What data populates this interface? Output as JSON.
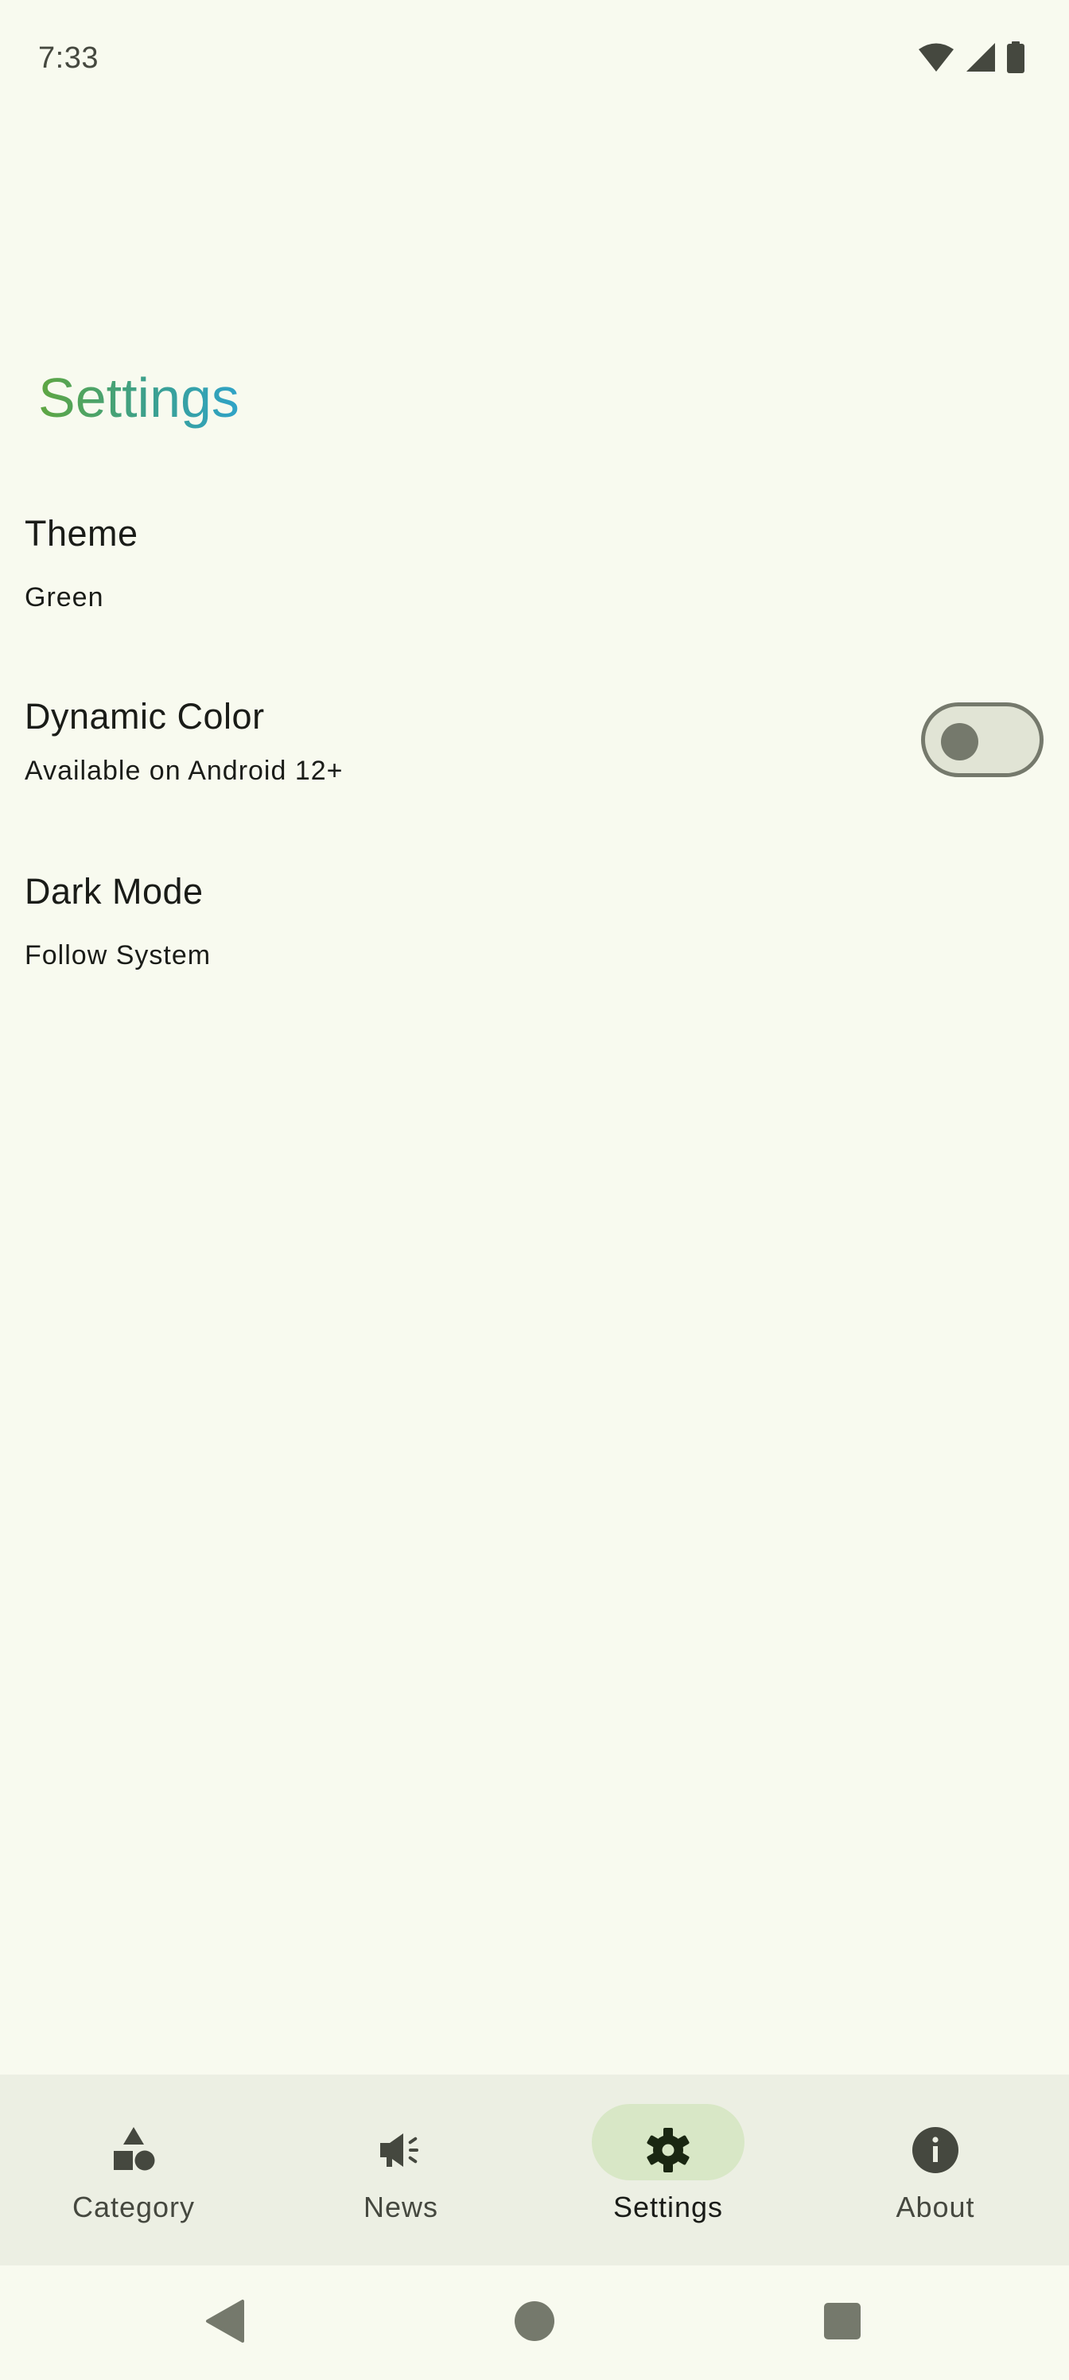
{
  "status_bar": {
    "time": "7:33",
    "icons": [
      "wifi-icon",
      "signal-icon",
      "battery-icon"
    ]
  },
  "page": {
    "title": "Settings"
  },
  "settings": {
    "theme": {
      "title": "Theme",
      "value": "Green"
    },
    "dynamic_color": {
      "title": "Dynamic Color",
      "subtitle": "Available on Android 12+",
      "enabled": false
    },
    "dark_mode": {
      "title": "Dark Mode",
      "value": "Follow System"
    }
  },
  "bottom_nav": {
    "items": [
      {
        "label": "Category",
        "icon": "category-shapes-icon",
        "selected": false
      },
      {
        "label": "News",
        "icon": "campaign-megaphone-icon",
        "selected": false
      },
      {
        "label": "Settings",
        "icon": "gear-icon",
        "selected": true
      },
      {
        "label": "About",
        "icon": "info-icon",
        "selected": false
      }
    ]
  },
  "system_nav": {
    "buttons": [
      "back-icon",
      "home-icon",
      "recents-icon"
    ]
  },
  "colors": {
    "background": "#F8FAEF",
    "nav_background": "#ECEFE3",
    "active_indicator": "#D8E7C6",
    "title_gradient_start": "#5FA640",
    "title_gradient_end": "#2FA3C8",
    "text_primary": "#1A1C18",
    "text_secondary": "#45483F"
  }
}
